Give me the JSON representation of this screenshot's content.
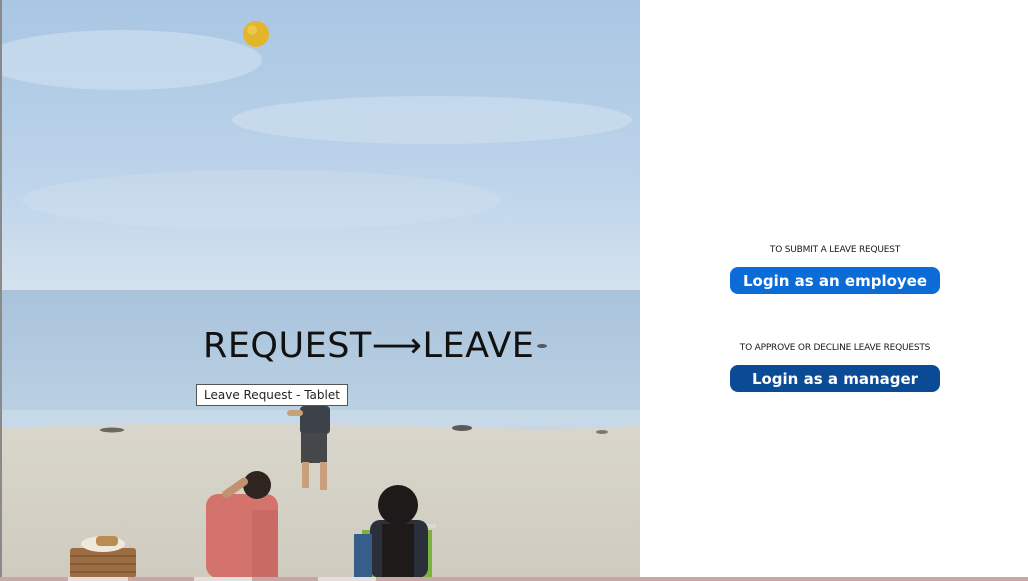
{
  "hero": {
    "title": "REQUEST⟶LEAVE",
    "tooltip": "Leave Request - Tablet"
  },
  "panel": {
    "employee": {
      "caption": "TO SUBMIT A LEAVE REQUEST",
      "button_label": "Login as an employee",
      "color": "#0b6cd8"
    },
    "manager": {
      "caption": "TO APPROVE OR DECLINE LEAVE REQUESTS",
      "button_label": "Login as a manager",
      "color": "#0b4a94"
    }
  }
}
